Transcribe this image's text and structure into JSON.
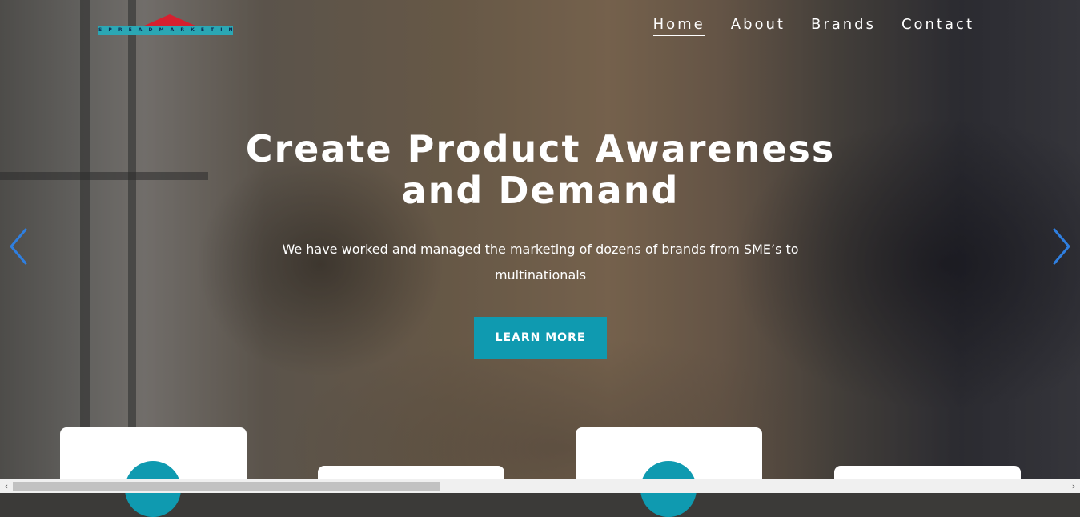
{
  "brand": {
    "logo_text": "S P R E A D   M A R K E T I N G",
    "logo_colors": {
      "roof": "#d6202f",
      "band": "#2ba7b4",
      "text": "#0b2a52"
    }
  },
  "nav": {
    "items": [
      {
        "label": "Home",
        "active": true
      },
      {
        "label": "About",
        "active": false
      },
      {
        "label": "Brands",
        "active": false
      },
      {
        "label": "Contact",
        "active": false
      }
    ]
  },
  "hero": {
    "headline_line1": "Create Product Awareness",
    "headline_line2": "and Demand",
    "subtext_line1": "We have worked and managed the marketing of dozens of brands from SME’s to",
    "subtext_line2": "multinationals",
    "cta_label": "LEARN MORE",
    "accent_color": "#0f9ab0",
    "arrow_color": "#2f7fe0",
    "prev_icon": "chevron-left-icon",
    "next_icon": "chevron-right-icon"
  },
  "scrollbar": {
    "left_icon": "‹",
    "right_icon": "›"
  }
}
